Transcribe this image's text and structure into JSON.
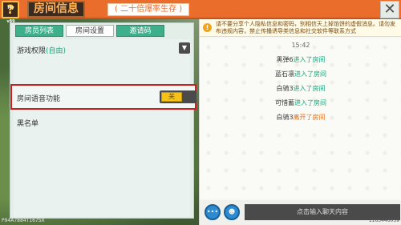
{
  "header": {
    "badge": "My v89",
    "help_icon": "?",
    "title": "房间信息",
    "mode": "( 二十倍爆率生存 )",
    "close_label": "✕"
  },
  "tabs": [
    {
      "label": "房员列表"
    },
    {
      "label": "房间设置"
    },
    {
      "label": "邀请码"
    }
  ],
  "settings": {
    "permission_label": "游戏权限",
    "permission_value": "(自由)",
    "voice_label": "房间语音功能",
    "voice_toggle": "关",
    "blacklist_label": "黑名单"
  },
  "chat": {
    "notice": "请不要分享个人隐私信息和密码，别相信天上掉馅饼的虚假消息。请勿发布违规内容，禁止传播诱导类信息和社交软件等联系方式",
    "time": "15:42",
    "messages": [
      {
        "name": "黑弹6",
        "action": "进入了房间",
        "type": "join"
      },
      {
        "name": "蓝石凛",
        "action": "进入了房间",
        "type": "join"
      },
      {
        "name": "白骑3",
        "action": "进入了房间",
        "type": "join"
      },
      {
        "name": "可惜蓄",
        "action": "进入了房间",
        "type": "join"
      },
      {
        "name": "白骑3",
        "action": "离开了房间",
        "type": "leave"
      }
    ],
    "input_placeholder": "点击输入聊天内容",
    "more_icon": "•••",
    "emoji_icon": "☻"
  },
  "footer": {
    "uid_left": "P94A7884T167SX",
    "uid_right": "1163446059"
  },
  "colors": {
    "accent": "#ea6d2c",
    "tab": "#3fae8a",
    "highlight_border": "#d01e1e",
    "toggle": "#f6c21a"
  }
}
